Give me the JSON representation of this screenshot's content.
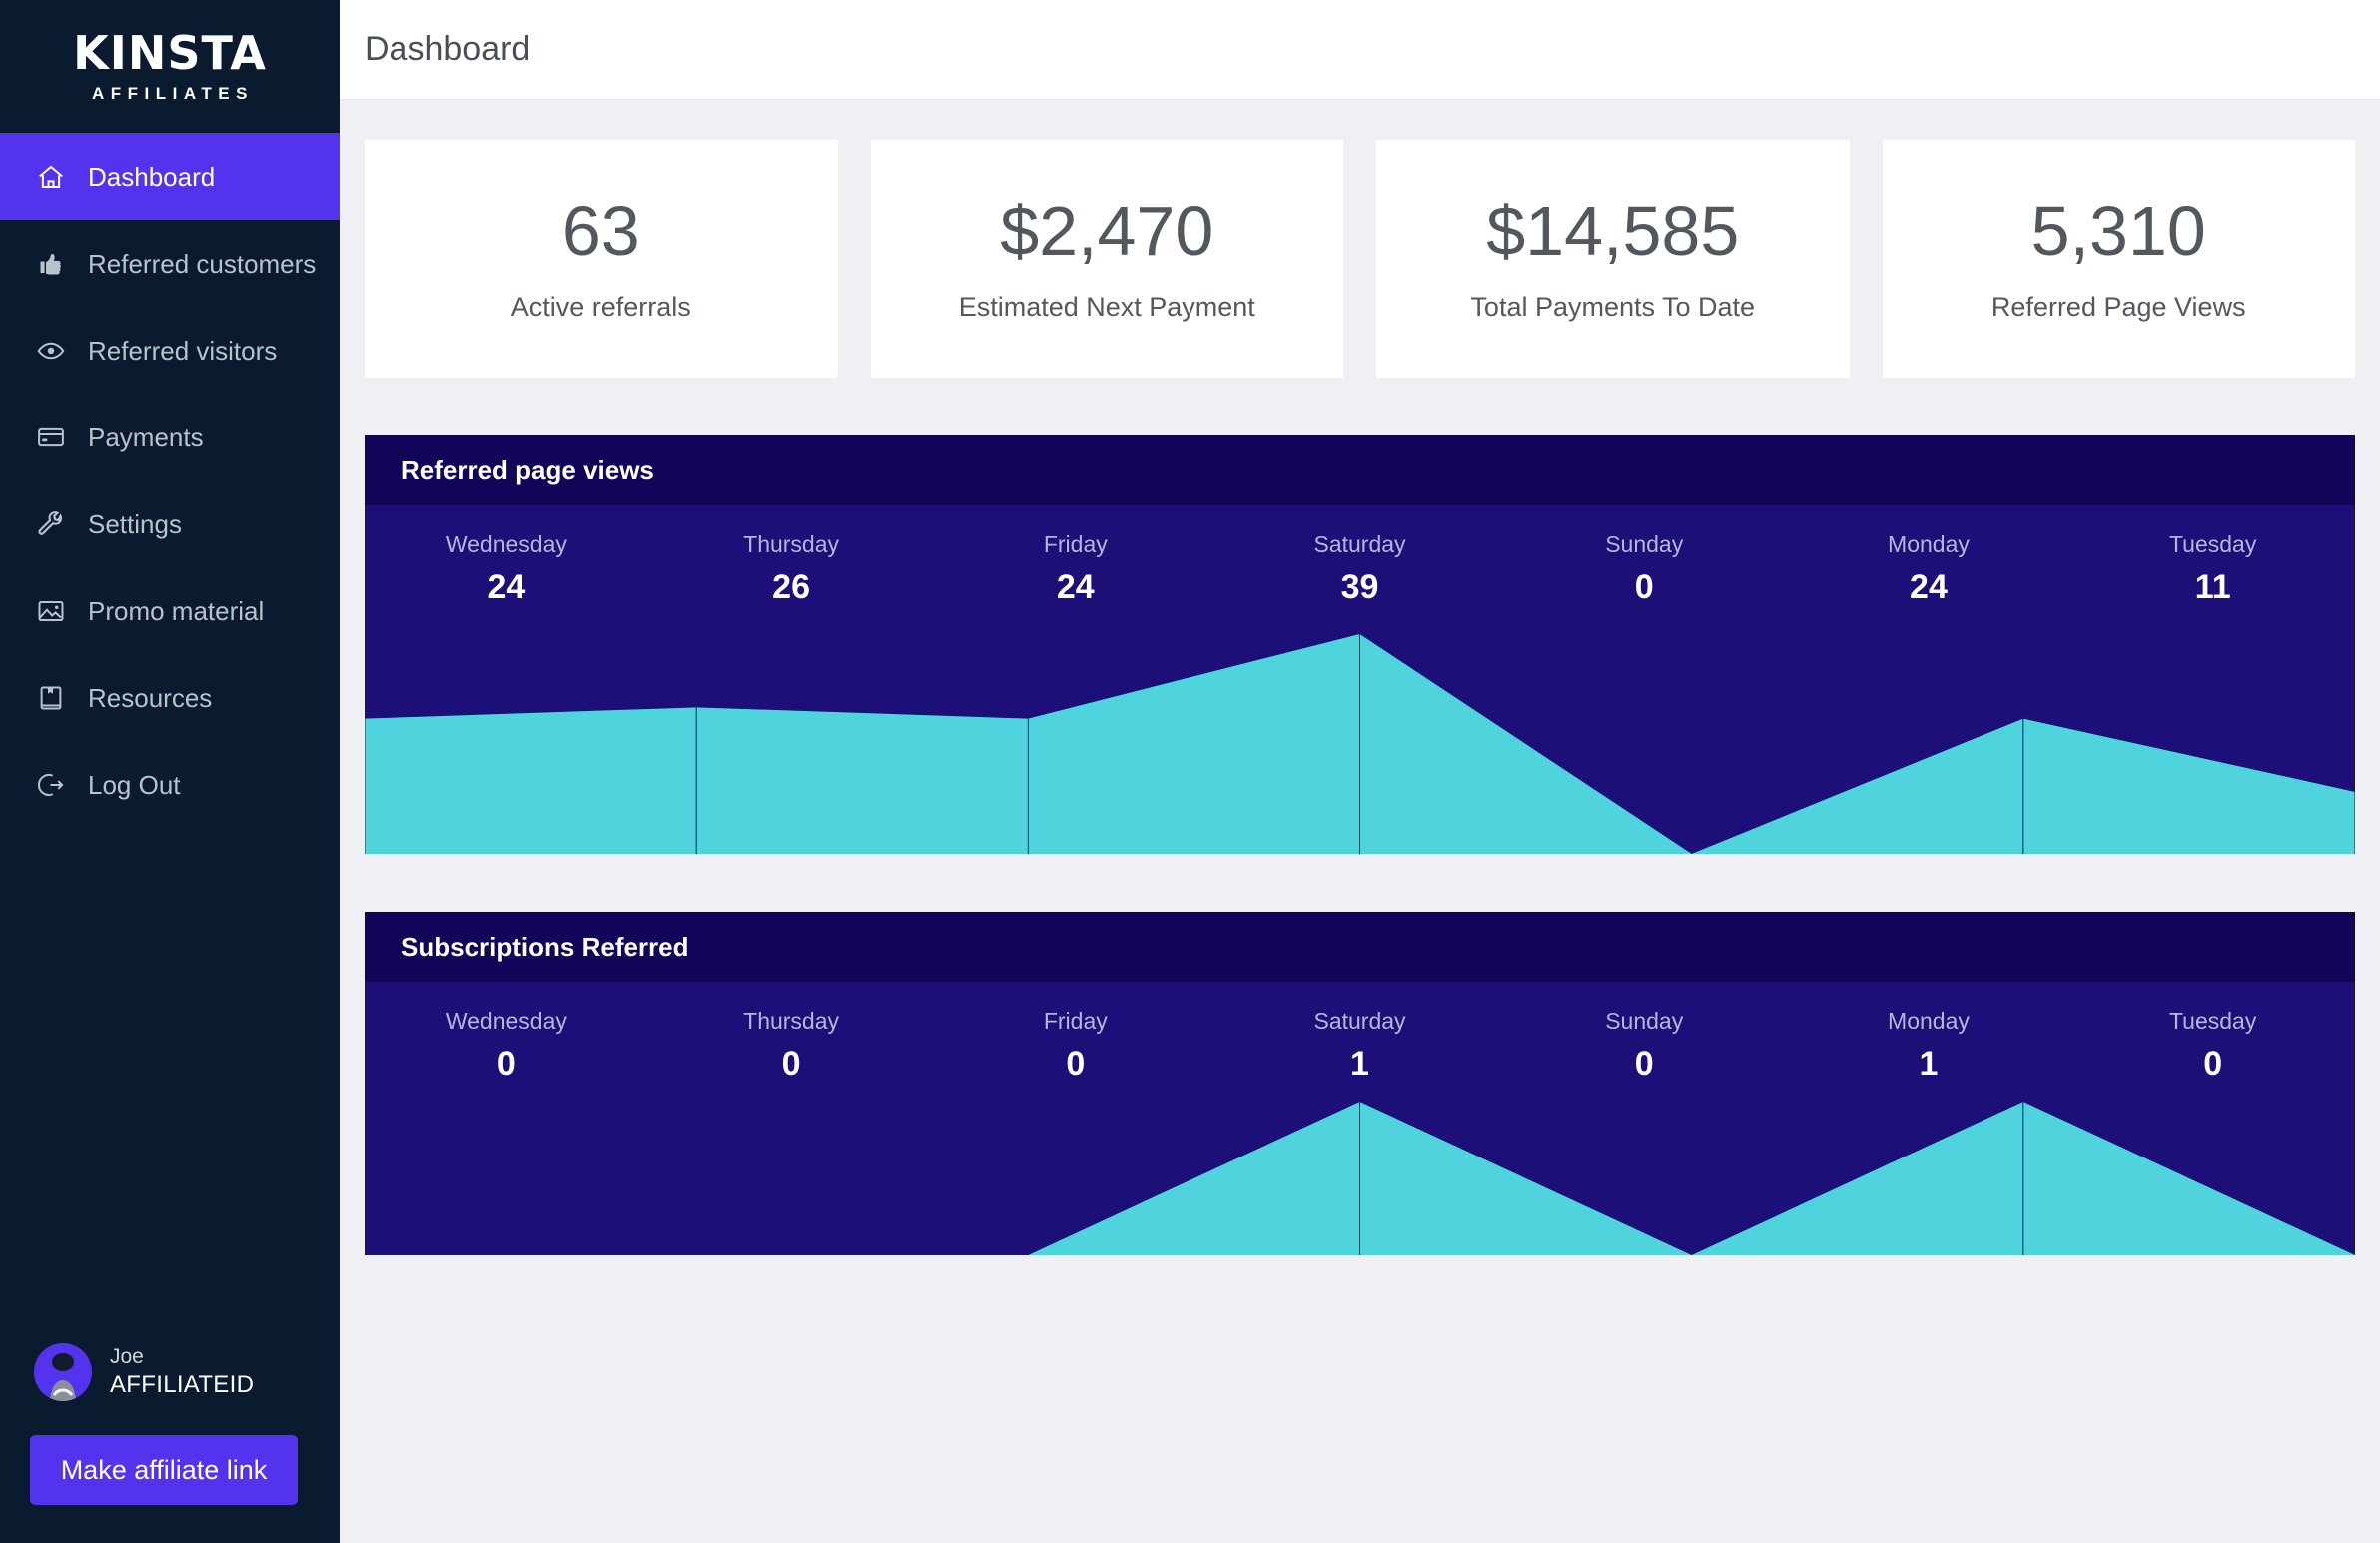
{
  "brand": {
    "name": "KINSTA",
    "tagline": "AFFILIATES"
  },
  "header": {
    "title": "Dashboard"
  },
  "sidebar": {
    "items": [
      {
        "label": "Dashboard",
        "icon": "home-icon",
        "active": true
      },
      {
        "label": "Referred customers",
        "icon": "thumbs-up-icon",
        "active": false
      },
      {
        "label": "Referred visitors",
        "icon": "eye-icon",
        "active": false
      },
      {
        "label": "Payments",
        "icon": "credit-card-icon",
        "active": false
      },
      {
        "label": "Settings",
        "icon": "wrench-icon",
        "active": false
      },
      {
        "label": "Promo material",
        "icon": "image-icon",
        "active": false
      },
      {
        "label": "Resources",
        "icon": "book-icon",
        "active": false
      },
      {
        "label": "Log Out",
        "icon": "sign-out-icon",
        "active": false
      }
    ],
    "profile": {
      "name": "Joe",
      "affiliate_id": "AFFILIATEID",
      "avatar": "user-avatar"
    },
    "cta_label": "Make affiliate link"
  },
  "stats": [
    {
      "value": "63",
      "label": "Active referrals"
    },
    {
      "value": "$2,470",
      "label": "Estimated Next Payment"
    },
    {
      "value": "$14,585",
      "label": "Total Payments To Date"
    },
    {
      "value": "5,310",
      "label": "Referred Page Views"
    }
  ],
  "colors": {
    "sidebar_bg": "#0a1a2f",
    "accent_purple": "#5333ee",
    "chart_header_bg": "#120458",
    "chart_body_bg": "#1d0f78",
    "chart_fill": "#4fd4de",
    "page_bg": "#eef0f4",
    "card_bg": "#ffffff"
  },
  "chart_data": [
    {
      "type": "area",
      "title": "Referred page views",
      "categories": [
        "Wednesday",
        "Thursday",
        "Friday",
        "Saturday",
        "Sunday",
        "Monday",
        "Tuesday"
      ],
      "values": [
        24,
        26,
        24,
        39,
        0,
        24,
        11
      ],
      "xlabel": "",
      "ylabel": "",
      "ylim": [
        0,
        39
      ],
      "grid": false,
      "legend": false
    },
    {
      "type": "area",
      "title": "Subscriptions Referred",
      "categories": [
        "Wednesday",
        "Thursday",
        "Friday",
        "Saturday",
        "Sunday",
        "Monday",
        "Tuesday"
      ],
      "values": [
        0,
        0,
        0,
        1,
        0,
        1,
        0
      ],
      "xlabel": "",
      "ylabel": "",
      "ylim": [
        0,
        1
      ],
      "grid": false,
      "legend": false
    }
  ]
}
